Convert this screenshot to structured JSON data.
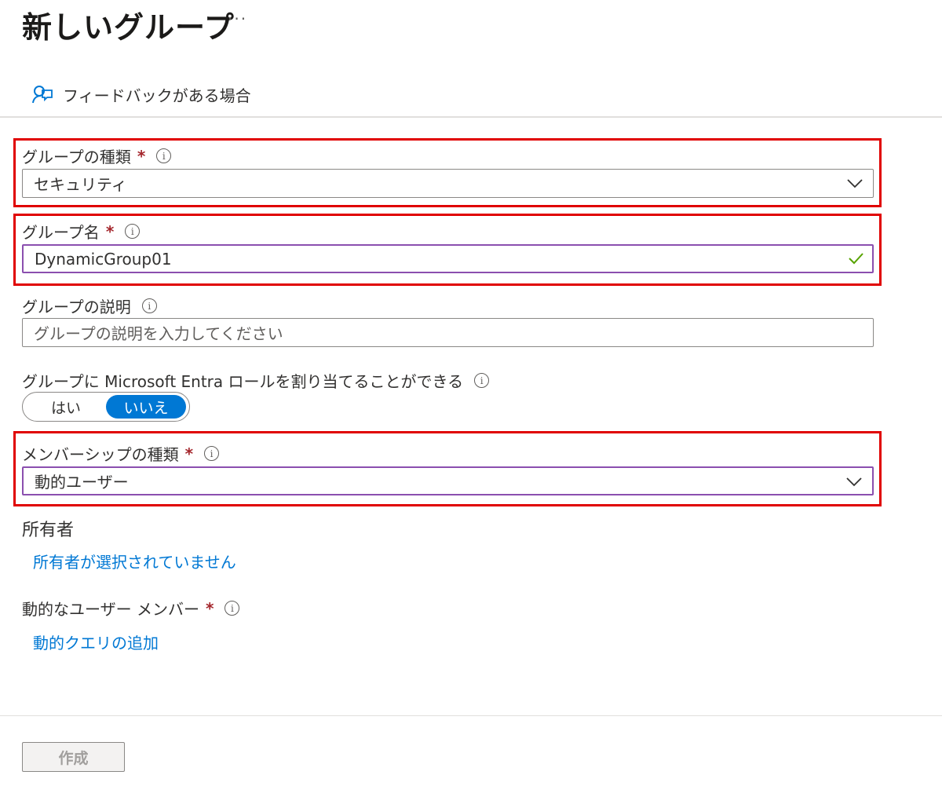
{
  "header": {
    "title": "新しいグループ",
    "more_label": "···",
    "feedback_label": "フィードバックがある場合"
  },
  "form": {
    "group_type": {
      "label": "グループの種類",
      "required_mark": "*",
      "info_mark": "i",
      "value": "セキュリティ"
    },
    "group_name": {
      "label": "グループ名",
      "required_mark": "*",
      "info_mark": "i",
      "value": "DynamicGroup01"
    },
    "group_description": {
      "label": "グループの説明",
      "info_mark": "i",
      "placeholder": "グループの説明を入力してください"
    },
    "entra_roles": {
      "label": "グループに Microsoft Entra ロールを割り当てることができる",
      "info_mark": "i",
      "options": [
        "はい",
        "いいえ"
      ],
      "selected": "いいえ"
    },
    "membership_type": {
      "label": "メンバーシップの種類",
      "required_mark": "*",
      "info_mark": "i",
      "value": "動的ユーザー"
    },
    "owners": {
      "label": "所有者",
      "link": "所有者が選択されていません"
    },
    "dynamic_members": {
      "label": "動的なユーザー メンバー",
      "required_mark": "*",
      "info_mark": "i",
      "link": "動的クエリの追加"
    }
  },
  "footer": {
    "create_label": "作成"
  },
  "colors": {
    "accent": "#0078d4",
    "highlight": "#e00000",
    "required": "#a4262c",
    "focus_border": "#8b4faf",
    "valid_check": "#57a300"
  }
}
